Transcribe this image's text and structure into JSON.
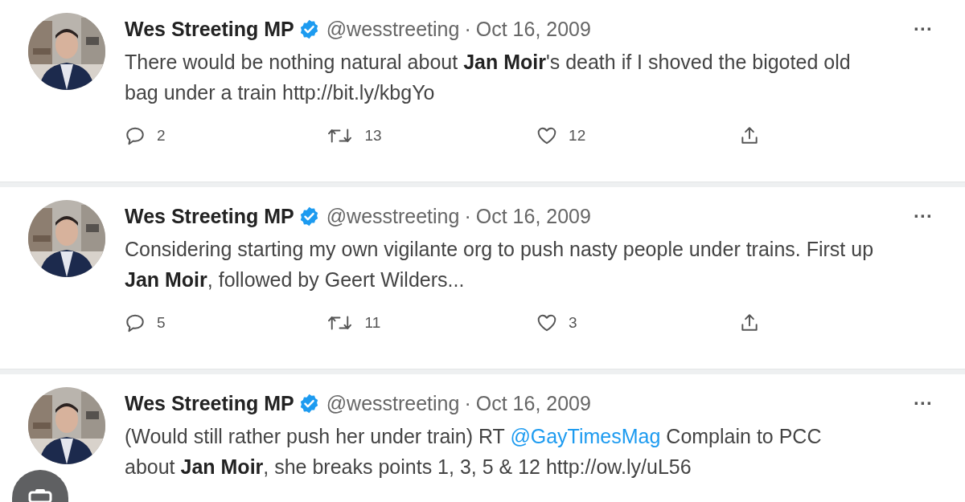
{
  "tweets": [
    {
      "author": {
        "name": "Wes Streeting MP",
        "verified": true,
        "handle": "@wesstreeting",
        "separator": "·",
        "date": "Oct 16, 2009"
      },
      "more": "···",
      "text": [
        {
          "kind": "plain",
          "text": "There would be nothing natural about "
        },
        {
          "kind": "bold",
          "text": "Jan Moir"
        },
        {
          "kind": "plain",
          "text": "'s death if I shoved the bigoted old bag under a train http://bit.ly/kbgYo"
        }
      ],
      "actions": {
        "replies": "2",
        "retweets": "13",
        "likes": "12"
      }
    },
    {
      "author": {
        "name": "Wes Streeting MP",
        "verified": true,
        "handle": "@wesstreeting",
        "separator": "·",
        "date": "Oct 16, 2009"
      },
      "more": "···",
      "text": [
        {
          "kind": "plain",
          "text": "Considering starting my own vigilante org to push nasty people under trains. First up "
        },
        {
          "kind": "bold",
          "text": "Jan Moir"
        },
        {
          "kind": "plain",
          "text": ", followed by Geert Wilders..."
        }
      ],
      "actions": {
        "replies": "5",
        "retweets": "11",
        "likes": "3"
      }
    },
    {
      "author": {
        "name": "Wes Streeting MP",
        "verified": true,
        "handle": "@wesstreeting",
        "separator": "·",
        "date": "Oct 16, 2009"
      },
      "more": "···",
      "text": [
        {
          "kind": "plain",
          "text": "(Would still rather push her under train) RT "
        },
        {
          "kind": "mention",
          "text": "@GayTimesMag"
        },
        {
          "kind": "plain",
          "text": " Complain to PCC about "
        },
        {
          "kind": "bold",
          "text": "Jan Moir"
        },
        {
          "kind": "plain",
          "text": ", she breaks points 1, 3, 5 & 12 http://ow.ly/uL56"
        }
      ]
    }
  ],
  "overlay_button": {
    "kind": "lens"
  }
}
